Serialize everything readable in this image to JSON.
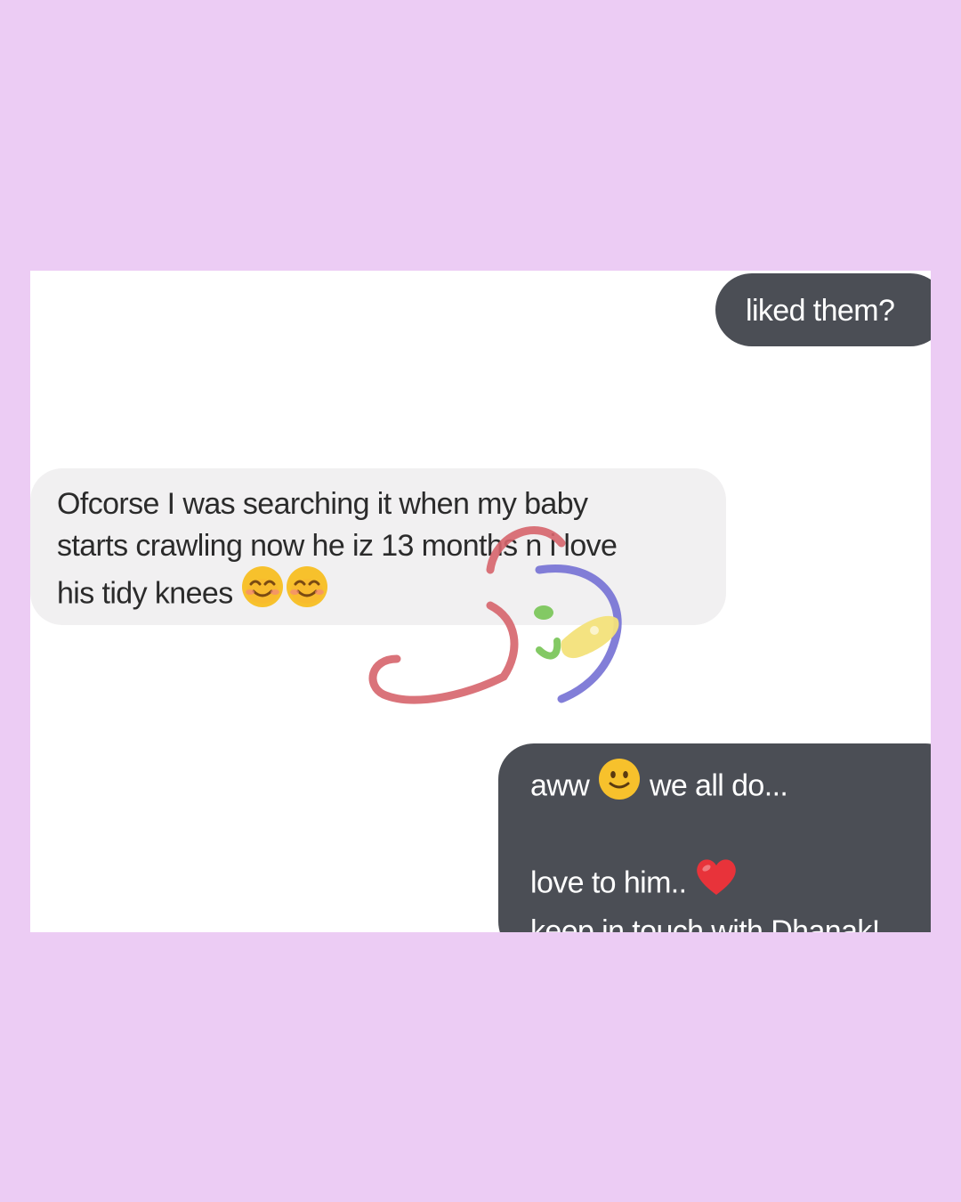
{
  "colors": {
    "page_background": "#ecccf4",
    "outgoing_bubble": "#4b4e55",
    "incoming_bubble": "#f1f0f1",
    "emoji_yellow": "#f7c12c",
    "heart_red": "#e8333a",
    "logo_red": "#d6646c",
    "logo_blue": "#7470d4",
    "logo_yellow": "#f3e17a",
    "logo_green": "#7cc65c"
  },
  "chat": {
    "messages": [
      {
        "direction": "outgoing",
        "lines": [
          "liked them?"
        ]
      },
      {
        "direction": "incoming",
        "lines": [
          "Ofcorse I was searching it when my baby",
          "starts crawling now he iz 13 months n i love",
          "his tidy knees"
        ],
        "trailing_icons": [
          "smiling-face-icon",
          "smiling-face-icon"
        ]
      },
      {
        "direction": "outgoing",
        "line1_before": "aww",
        "line1_icon": "slightly-smiling-face-icon",
        "line1_after": "we all do...",
        "line2_text": "love to him..",
        "line2_icon": "red-heart-icon",
        "line3_text": "keep in touch with Dhanak!"
      }
    ]
  },
  "watermark": {
    "icon": "dhanak-rainbow-logo-icon"
  }
}
